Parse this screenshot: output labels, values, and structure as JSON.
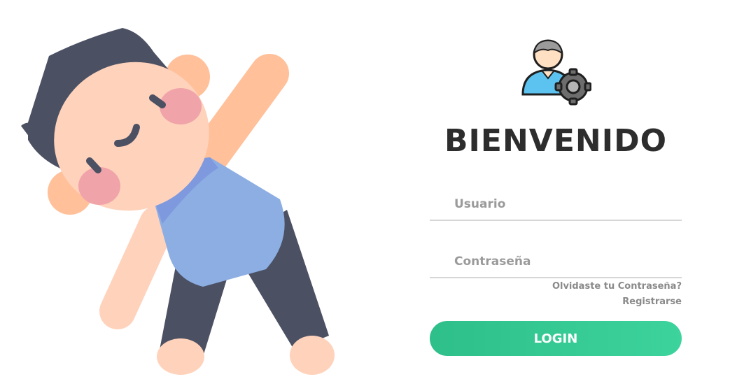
{
  "colors": {
    "accent": "#33c590",
    "title": "#2d2d2d",
    "muted": "#8a8a8a",
    "underline": "#d6d6d6",
    "skin": "#ffd2bb",
    "hair": "#4b5063",
    "shirt": "#8daee3"
  },
  "icons": {
    "hero": "exercising-boy-illustration",
    "avatar": "user-settings-icon"
  },
  "login": {
    "title": "BIENVENIDO",
    "username_placeholder": "Usuario",
    "username_value": "",
    "password_placeholder": "Contraseña",
    "password_value": "",
    "forgot_link": "Olvidaste tu Contraseña?",
    "register_link": "Registrarse",
    "login_button": "LOGIN"
  }
}
